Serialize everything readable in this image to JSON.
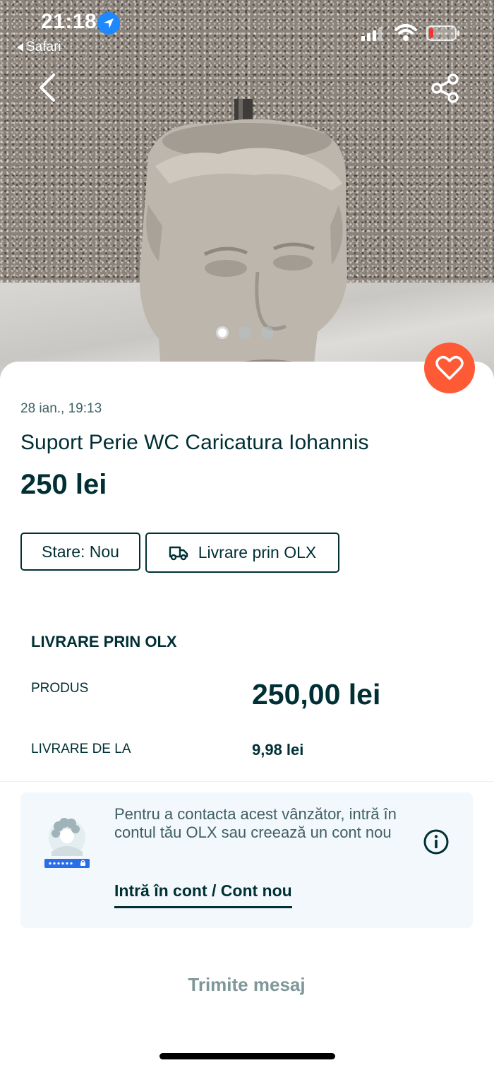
{
  "status_bar": {
    "time": "21:18",
    "back_app": "Safari",
    "icons": [
      "location-icon",
      "signal-icon",
      "wifi-icon",
      "battery-icon"
    ],
    "battery_level": 0.1
  },
  "gallery": {
    "image_count": 3,
    "active_index": 1,
    "nav_icons": [
      "back-arrow-icon",
      "share-icon"
    ]
  },
  "listing": {
    "date": "28 ian., 19:13",
    "title": "Suport Perie WC Caricatura Iohannis",
    "price": "250 lei",
    "tags": {
      "state": "Stare: Nou",
      "delivery": "Livrare prin OLX"
    }
  },
  "delivery": {
    "section_title": "LIVRARE PRIN OLX",
    "product_label": "PRODUS",
    "product_value": "250,00 lei",
    "shipping_label": "LIVRARE DE LA",
    "shipping_value": "9,98 lei"
  },
  "contact": {
    "text": "Pentru a contacta acest vânzător, intră în contul tău OLX sau creează un cont nou",
    "link": "Intră în cont / Cont nou"
  },
  "actions": {
    "send_message": "Trimite mesaj"
  },
  "colors": {
    "brand_dark": "#002f34",
    "favorite": "#ff5a36",
    "card_bg": "#f2f8fb",
    "link_blue": "#1e88ff"
  }
}
